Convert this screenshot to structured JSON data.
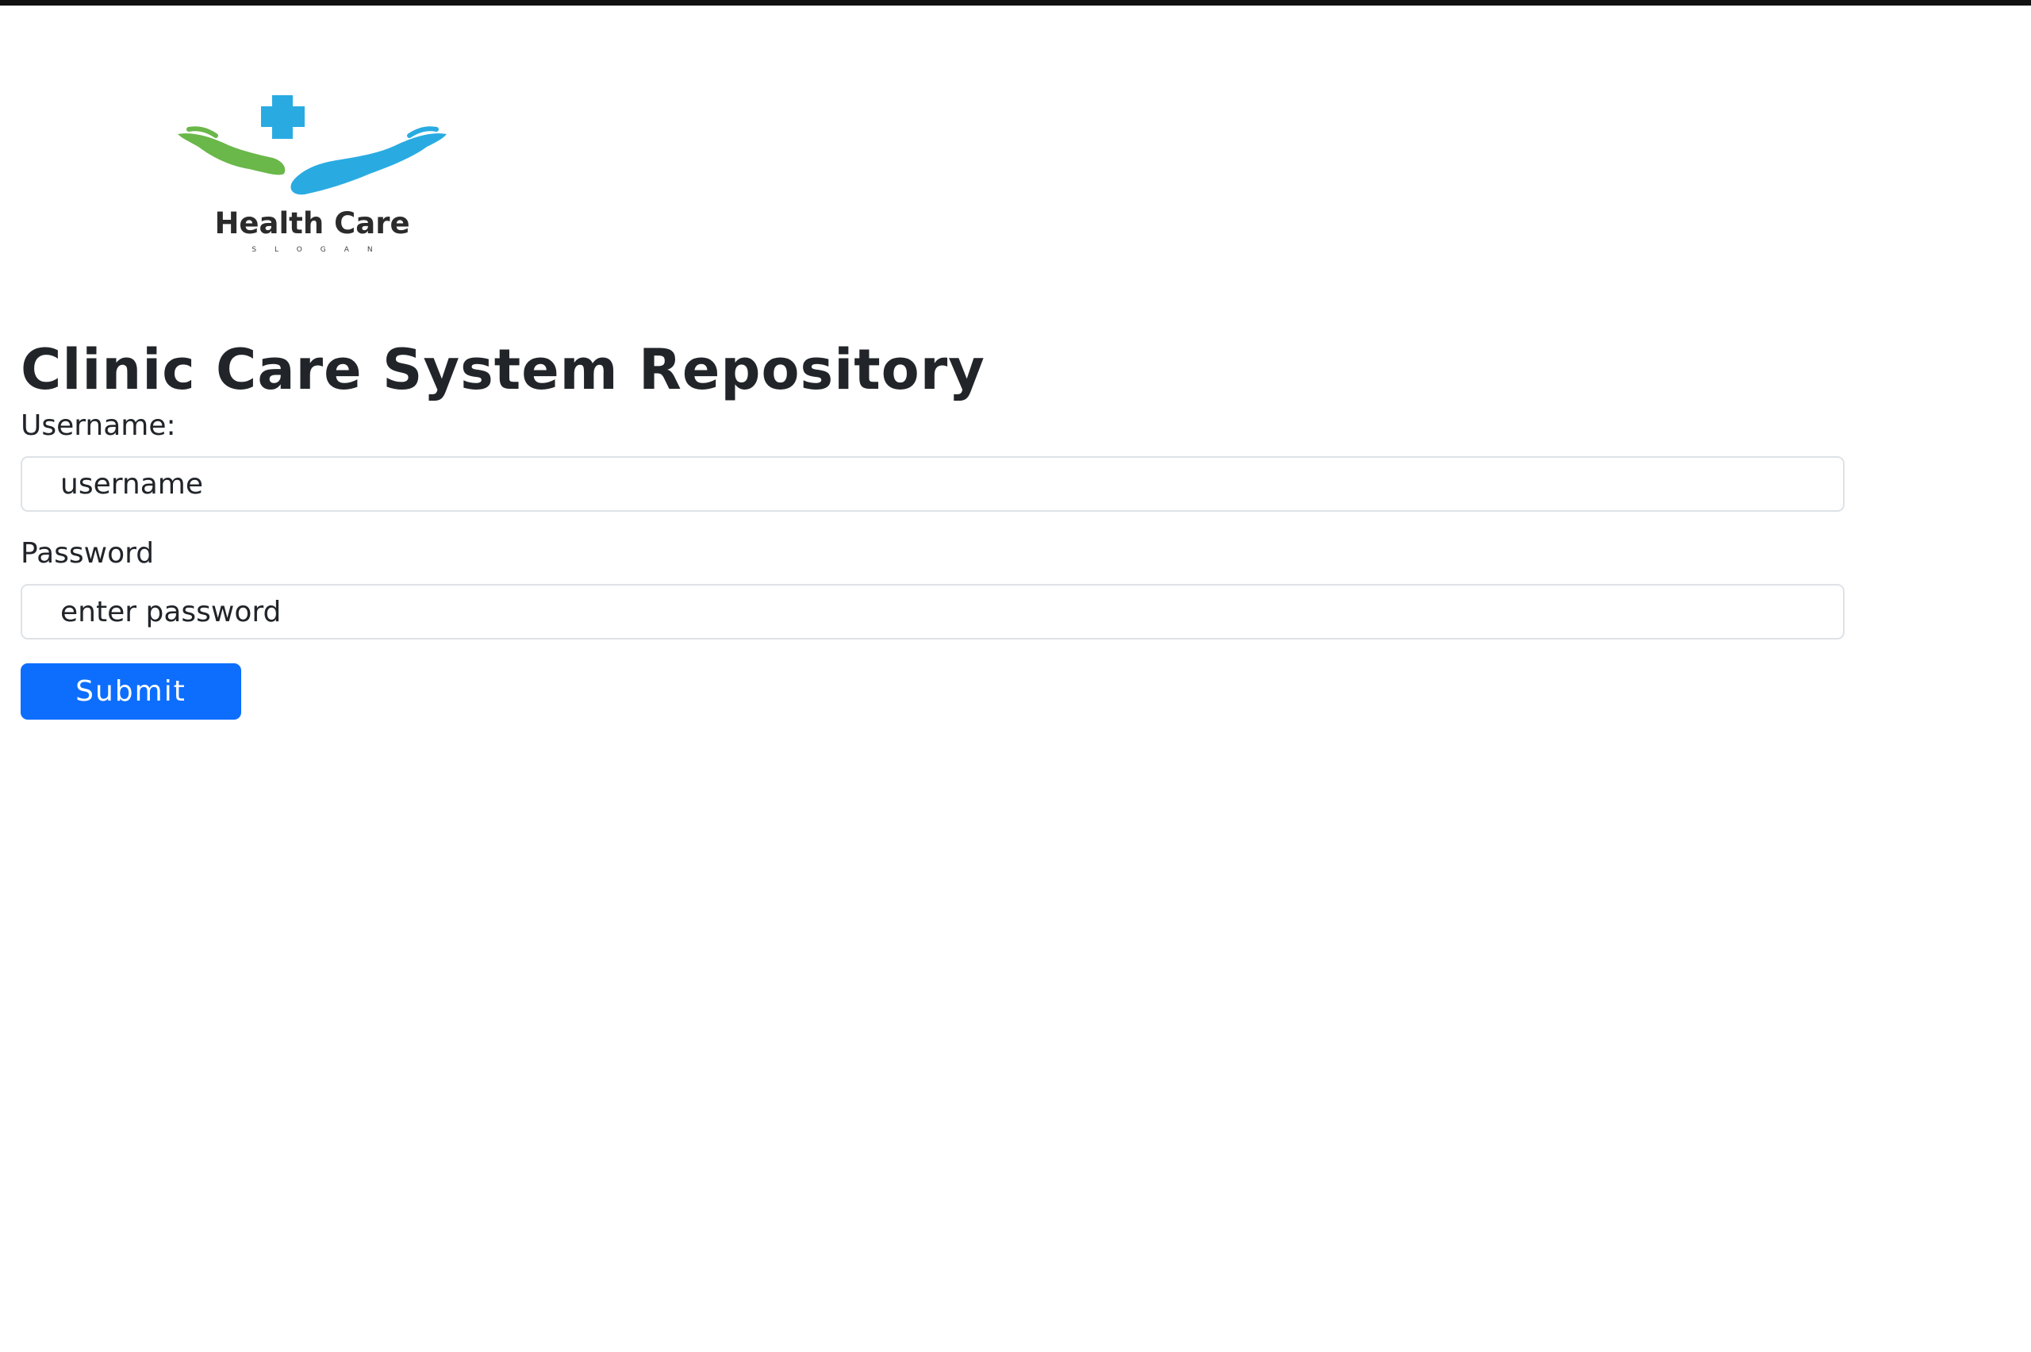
{
  "logo": {
    "title": "Health Care",
    "slogan": "SLOGAN",
    "colors": {
      "cross": "#29abe2",
      "left_hand": "#6ab74a",
      "right_hand": "#29abe2"
    }
  },
  "page": {
    "title": "Clinic Care System Repository"
  },
  "form": {
    "username_label": "Username:",
    "username_placeholder": "username",
    "username_value": "",
    "password_label": "Password",
    "password_placeholder": "enter password",
    "password_value": "",
    "submit_label": "Submit"
  },
  "colors": {
    "primary_button": "#0d6efd",
    "text": "#212529",
    "input_border": "#dee2e6"
  }
}
